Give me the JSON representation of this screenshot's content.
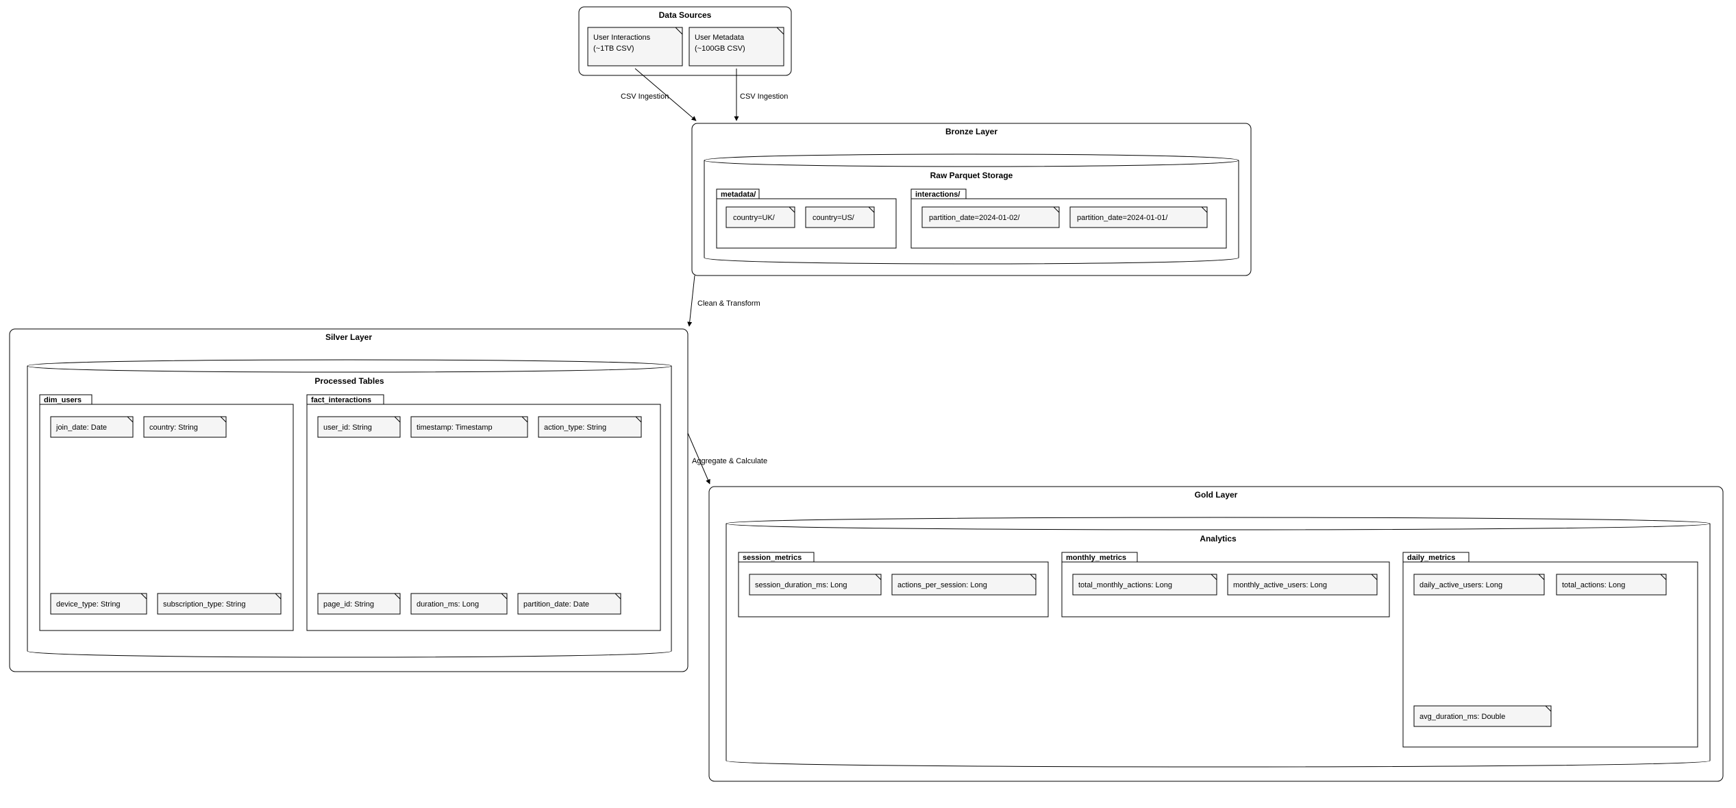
{
  "layers": {
    "sources": {
      "title": "Data Sources"
    },
    "bronze": {
      "title": "Bronze Layer"
    },
    "silver": {
      "title": "Silver Layer"
    },
    "gold": {
      "title": "Gold Layer"
    }
  },
  "databases": {
    "raw_parquet": "Raw Parquet Storage",
    "processed_tables": "Processed Tables",
    "analytics": "Analytics"
  },
  "notes": {
    "src_interactions_l1": "User Interactions",
    "src_interactions_l2": "(~1TB CSV)",
    "src_metadata_l1": "User Metadata",
    "src_metadata_l2": "(~100GB CSV)"
  },
  "folders": {
    "metadata": "metadata/",
    "interactions": "interactions/",
    "dim_users": "dim_users",
    "fact_interactions": "fact_interactions",
    "session_metrics": "session_metrics",
    "monthly_metrics": "monthly_metrics",
    "daily_metrics": "daily_metrics"
  },
  "items": {
    "country_uk": "country=UK/",
    "country_us": "country=US/",
    "part_0102": "partition_date=2024-01-02/",
    "part_0101": "partition_date=2024-01-01/",
    "join_date": "join_date: Date",
    "country_str": "country: String",
    "device_type": "device_type: String",
    "subscription_type": "subscription_type: String",
    "user_id": "user_id: String",
    "timestamp": "timestamp: Timestamp",
    "action_type": "action_type: String",
    "page_id": "page_id: String",
    "duration_ms": "duration_ms: Long",
    "partition_date": "partition_date: Date",
    "session_duration": "session_duration_ms: Long",
    "actions_per_sess": "actions_per_session: Long",
    "total_monthly": "total_monthly_actions: Long",
    "monthly_active": "monthly_active_users: Long",
    "daily_active": "daily_active_users: Long",
    "total_actions": "total_actions: Long",
    "avg_duration": "avg_duration_ms: Double"
  },
  "edges": {
    "csv_ingestion_1": "CSV Ingestion",
    "csv_ingestion_2": "CSV Ingestion",
    "clean_transform": "Clean & Transform",
    "aggregate_calc": "Aggregate & Calculate"
  }
}
